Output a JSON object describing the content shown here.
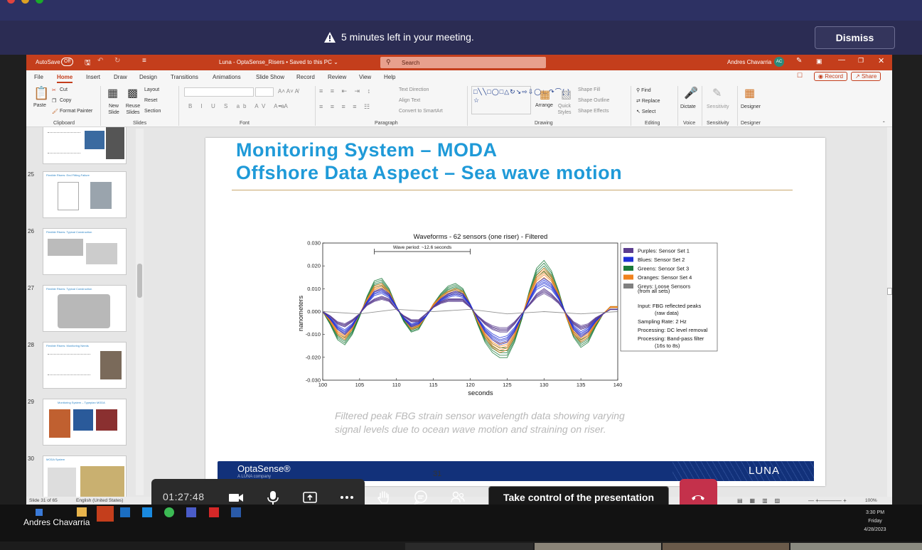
{
  "banner": {
    "message": "5 minutes left in your meeting.",
    "dismiss_label": "Dismiss"
  },
  "ppt": {
    "autosave_label": "AutoSave",
    "autosave_state": "Off",
    "doc_title": "Luna - OptaSense_Risers  •  Saved to this PC ⌄",
    "search_placeholder": "Search",
    "user_name": "Andres Chavarria",
    "user_initials": "AC",
    "record_label": "Record",
    "share_label": "Share",
    "menu": [
      "File",
      "Home",
      "Insert",
      "Draw",
      "Design",
      "Transitions",
      "Animations",
      "Slide Show",
      "Record",
      "Review",
      "View",
      "Help"
    ],
    "ribbon": {
      "paste": "Paste",
      "cut": "Cut",
      "copy": "Copy",
      "format_painter": "Format Painter",
      "new_slide": "New Slide",
      "reuse_slides": "Reuse Slides",
      "layout": "Layout",
      "reset": "Reset",
      "section": "Section",
      "text_direction": "Text Direction",
      "align_text": "Align Text",
      "convert_smartart": "Convert to SmartArt",
      "arrange": "Arrange",
      "quick_styles": "Quick Styles",
      "shape_fill": "Shape Fill",
      "shape_outline": "Shape Outline",
      "shape_effects": "Shape Effects",
      "find": "Find",
      "replace": "Replace",
      "select": "Select",
      "dictate": "Dictate",
      "sensitivity": "Sensitivity",
      "designer": "Designer",
      "groups": [
        "Clipboard",
        "Slides",
        "Font",
        "Paragraph",
        "Drawing",
        "Editing",
        "Voice",
        "Sensitivity",
        "Designer"
      ]
    },
    "thumbs": [
      {
        "num": "",
        "title": ""
      },
      {
        "num": "25",
        "title": "Flexible Risers: End Fitting Failure"
      },
      {
        "num": "26",
        "title": "Flexible Risers: Typical Construction"
      },
      {
        "num": "27",
        "title": "Flexible Risers: Typical Construction"
      },
      {
        "num": "28",
        "title": "Flexible Risers: Monitoring Needs"
      },
      {
        "num": "29",
        "title": "Monitoring System – Typeplan MODA"
      },
      {
        "num": "30",
        "title": "MODA System"
      }
    ],
    "status": {
      "slide": "Slide 31 of 65",
      "lang": "English (United States)",
      "zoom": "100%"
    }
  },
  "slide": {
    "title1": "Monitoring System – MODA",
    "title2": "Offshore Data Aspect – Sea wave motion",
    "caption1": "Filtered peak FBG strain sensor wavelength data showing varying",
    "caption2": "signal levels due to ocean wave motion and straining on riser.",
    "footer_left": "OptaSense®",
    "footer_sub": "A LUNA company",
    "footer_right": "LUNA",
    "slide_number": "31"
  },
  "chart_data": {
    "type": "line",
    "title": "Waveforms - 62 sensors (one riser) - Filtered",
    "xlabel": "seconds",
    "ylabel": "nanometers",
    "xlim": [
      100,
      140
    ],
    "ylim": [
      -0.03,
      0.03
    ],
    "xticks": [
      "100",
      "105",
      "110",
      "115",
      "120",
      "125",
      "130",
      "135",
      "140"
    ],
    "yticks": [
      "0.030",
      "0.020",
      "0.010",
      "0.000",
      "-0.010",
      "-0.020",
      "-0.030"
    ],
    "annotation": "Wave period: ~12.6 seconds",
    "annotation_range": [
      107,
      120
    ],
    "legend_placement": "right",
    "legend": [
      {
        "label": "Purples: Sensor Set 1",
        "color": "#5b3d8f"
      },
      {
        "label": "Blues: Sensor Set 2",
        "color": "#1f2fd6"
      },
      {
        "label": "Greens: Sensor Set 3",
        "color": "#1a7a3a"
      },
      {
        "label": "Oranges: Sensor Set 4",
        "color": "#f0821e"
      },
      {
        "label": "Greys: Loose Sensors",
        "color": "#808080"
      }
    ],
    "legend_sub": "(from all sets)",
    "notes": [
      [
        "Input: FBG reflected peaks",
        "(raw data)"
      ],
      [
        "Sampling Rate: 2 Hz"
      ],
      [
        "Processing: DC level removal"
      ],
      [
        "Processing: Band-pass filter",
        "(16s to 8s)"
      ]
    ],
    "series": [
      {
        "name": "Greens: Sensor Set 3",
        "color": "#1a7a3a",
        "x": [
          100,
          101,
          102,
          103,
          104,
          105,
          106,
          107,
          108,
          109,
          110,
          111,
          112,
          113,
          114,
          115,
          116,
          117,
          118,
          119,
          120,
          121,
          122,
          123,
          124,
          125,
          126,
          127,
          128,
          129,
          130,
          131,
          132,
          133,
          134,
          135,
          136,
          137,
          138,
          139,
          140
        ],
        "y": [
          0.0,
          -0.005,
          -0.011,
          -0.013,
          -0.009,
          -0.002,
          0.006,
          0.012,
          0.013,
          0.009,
          0.002,
          -0.004,
          -0.008,
          -0.007,
          -0.002,
          0.003,
          0.007,
          0.01,
          0.011,
          0.009,
          0.003,
          -0.005,
          -0.012,
          -0.016,
          -0.018,
          -0.018,
          -0.012,
          -0.003,
          0.008,
          0.017,
          0.02,
          0.016,
          0.008,
          -0.002,
          -0.01,
          -0.014,
          -0.012,
          -0.006,
          -0.001,
          0.002,
          0.002
        ]
      },
      {
        "name": "Oranges: Sensor Set 4",
        "color": "#f0821e",
        "x": [
          100,
          101,
          102,
          103,
          104,
          105,
          106,
          107,
          108,
          109,
          110,
          111,
          112,
          113,
          114,
          115,
          116,
          117,
          118,
          119,
          120,
          121,
          122,
          123,
          124,
          125,
          126,
          127,
          128,
          129,
          130,
          131,
          132,
          133,
          134,
          135,
          136,
          137,
          138,
          139,
          140
        ],
        "y": [
          0.0,
          -0.004,
          -0.009,
          -0.011,
          -0.007,
          -0.001,
          0.005,
          0.01,
          0.011,
          0.008,
          0.002,
          -0.003,
          -0.007,
          -0.006,
          -0.002,
          0.003,
          0.006,
          0.008,
          0.009,
          0.008,
          0.003,
          -0.004,
          -0.01,
          -0.014,
          -0.016,
          -0.015,
          -0.01,
          -0.002,
          0.007,
          0.014,
          0.017,
          0.014,
          0.007,
          -0.002,
          -0.009,
          -0.012,
          -0.01,
          -0.005,
          -0.001,
          0.002,
          0.002
        ]
      },
      {
        "name": "Blues: Sensor Set 2",
        "color": "#1f2fd6",
        "x": [
          100,
          101,
          102,
          103,
          104,
          105,
          106,
          107,
          108,
          109,
          110,
          111,
          112,
          113,
          114,
          115,
          116,
          117,
          118,
          119,
          120,
          121,
          122,
          123,
          124,
          125,
          126,
          127,
          128,
          129,
          130,
          131,
          132,
          133,
          134,
          135,
          136,
          137,
          138,
          139,
          140
        ],
        "y": [
          0.0,
          -0.003,
          -0.007,
          -0.009,
          -0.006,
          -0.001,
          0.004,
          0.008,
          0.009,
          0.007,
          0.002,
          -0.003,
          -0.006,
          -0.005,
          -0.002,
          0.002,
          0.005,
          0.007,
          0.008,
          0.007,
          0.003,
          -0.003,
          -0.008,
          -0.011,
          -0.013,
          -0.012,
          -0.008,
          -0.002,
          0.005,
          0.011,
          0.013,
          0.011,
          0.006,
          -0.001,
          -0.007,
          -0.01,
          -0.008,
          -0.004,
          -0.001,
          0.001,
          0.001
        ]
      },
      {
        "name": "Purples: Sensor Set 1",
        "color": "#5b3d8f",
        "x": [
          100,
          101,
          102,
          103,
          104,
          105,
          106,
          107,
          108,
          109,
          110,
          111,
          112,
          113,
          114,
          115,
          116,
          117,
          118,
          119,
          120,
          121,
          122,
          123,
          124,
          125,
          126,
          127,
          128,
          129,
          130,
          131,
          132,
          133,
          134,
          135,
          136,
          137,
          138,
          139,
          140
        ],
        "y": [
          0.0,
          -0.002,
          -0.005,
          -0.006,
          -0.004,
          -0.001,
          0.003,
          0.005,
          0.006,
          0.005,
          0.001,
          -0.002,
          -0.004,
          -0.004,
          -0.001,
          0.002,
          0.004,
          0.005,
          0.005,
          0.005,
          0.002,
          -0.002,
          -0.005,
          -0.007,
          -0.008,
          -0.008,
          -0.005,
          -0.001,
          0.003,
          0.007,
          0.009,
          0.007,
          0.004,
          -0.001,
          -0.005,
          -0.007,
          -0.006,
          -0.003,
          -0.001,
          0.001,
          0.001
        ]
      },
      {
        "name": "Greys: Loose Sensors",
        "color": "#808080",
        "x": [
          100,
          105,
          110,
          115,
          120,
          125,
          130,
          135,
          140
        ],
        "y": [
          0.0,
          -0.001,
          0.001,
          0.0,
          0.001,
          -0.001,
          0.0,
          -0.001,
          0.0
        ]
      }
    ]
  },
  "meeting": {
    "timer": "01:27:48",
    "take_control": "Take control of the presentation",
    "presenter": "Andres Chavarria"
  },
  "taskbar": {
    "time": "3:30 PM",
    "day": "Friday",
    "date": "4/28/2023"
  }
}
